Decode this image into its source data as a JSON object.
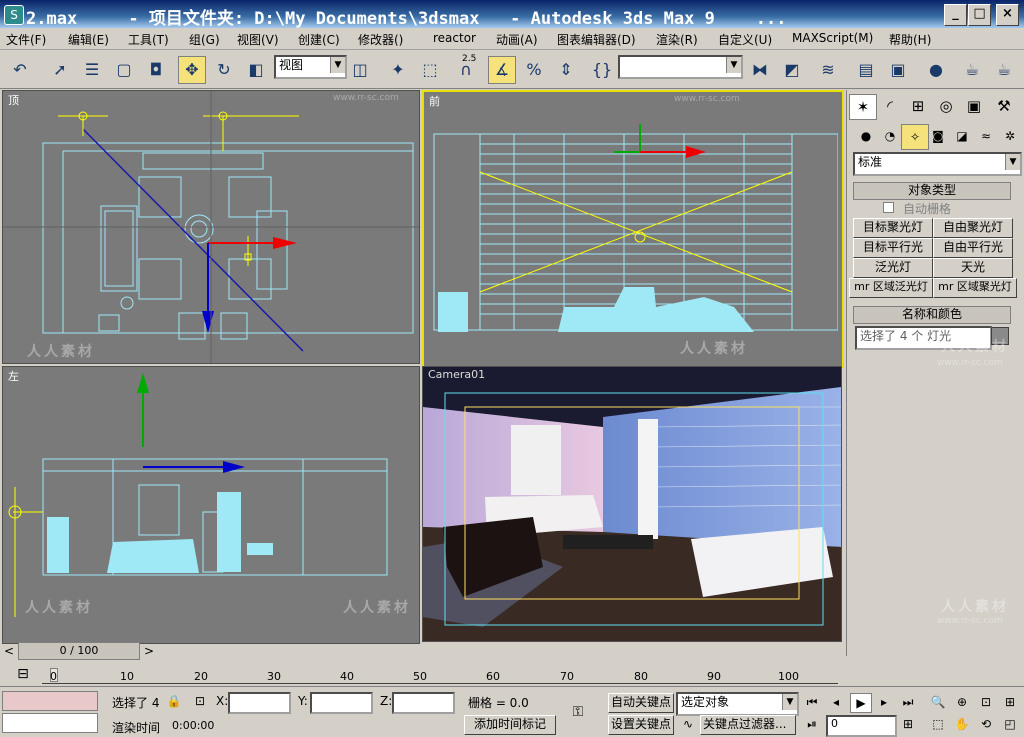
{
  "titlebar": {
    "title": "2.max     - 项目文件夹: D:\\My Documents\\3dsmax   - Autodesk 3ds Max 9    ...",
    "minimize": "_",
    "maximize": "□",
    "close": "×"
  },
  "menubar": {
    "items": [
      "文件(F)",
      "编辑(E)",
      "工具(T)",
      "组(G)",
      "视图(V)",
      "创建(C)",
      "修改器()",
      "reactor",
      "动画(A)",
      "图表编辑器(D)",
      "渲染(R)",
      "自定义(U)",
      "MAXScript(M)",
      "帮助(H)"
    ]
  },
  "toolbar": {
    "view_dropdown": "视图",
    "snap_angle": "2.5",
    "selection_set": ""
  },
  "viewports": {
    "top_label": "顶",
    "front_label": "前",
    "left_label": "左",
    "camera_label": "Camera01",
    "watermark": "人人素材",
    "watermark_url": "www.rr-sc.com"
  },
  "command_panel": {
    "category_dropdown": "标准",
    "object_type_header": "对象类型",
    "autogrid_label": "自动栅格",
    "buttons": [
      "目标聚光灯",
      "自由聚光灯",
      "目标平行光",
      "自由平行光",
      "泛光灯",
      "天光",
      "mr 区域泛光灯",
      "mr 区域聚光灯"
    ],
    "name_color_header": "名称和颜色",
    "name_value": "选择了 4 个 灯光",
    "name_color": "#8a8a8a"
  },
  "timeline": {
    "frame_counter": "0 / 100",
    "ticks": [
      "0",
      "10",
      "20",
      "30",
      "40",
      "50",
      "60",
      "70",
      "80",
      "90",
      "100"
    ]
  },
  "status": {
    "selected_text": "选择了 4",
    "x_label": "X:",
    "y_label": "Y:",
    "z_label": "Z:",
    "grid_text": "栅格 = 0.0",
    "render_time_label": "渲染时间",
    "render_time_value": "0:00:00",
    "add_time_tag": "添加时间标记",
    "auto_key": "自动关键点",
    "set_key": "设置关键点",
    "selected_object_dropdown": "选定对象",
    "key_filters": "关键点过滤器...",
    "current_frame": "0"
  },
  "colors": {
    "titlebar_start": "#0a246a",
    "viewport_bg": "#7a7a7a",
    "wireframe": "#9fe8f5",
    "active_viewport_border": "#e8e000"
  }
}
